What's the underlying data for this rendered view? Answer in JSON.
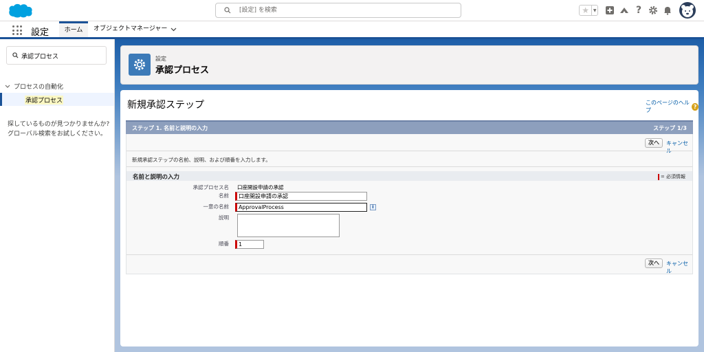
{
  "header": {
    "search_placeholder": "[設定] を検索"
  },
  "app_nav": {
    "app_name": "設定",
    "tabs": [
      {
        "label": "ホーム"
      },
      {
        "label": "オブジェクトマネージャー"
      }
    ]
  },
  "sidebar": {
    "quick_find_value": "承認プロセス",
    "tree_parent": "プロセスの自動化",
    "tree_child": "承認プロセス",
    "not_found_line1": "探しているものが見つかりませんか?",
    "not_found_line2": "グローバル検索をお試しください。"
  },
  "page_header": {
    "breadcrumb": "設定",
    "title": "承認プロセス"
  },
  "content": {
    "title": "新規承認ステップ",
    "help_link": "このページのヘルプ",
    "step_label": "ステップ 1. 名前と説明の入力",
    "step_count": "ステップ 1/3",
    "next_button": "次へ",
    "cancel_link": "キャンセル",
    "intro": "新規承認ステップの名前、説明、および順番を入力します。",
    "section_title": "名前と説明の入力",
    "required_info": "= 必須情報",
    "fields": {
      "process_name_label": "承認プロセス名",
      "process_name_value": "口座開設申請の承認",
      "name_label": "名前",
      "name_value": "口座開設申請の承認",
      "unique_name_label": "一意の名前",
      "unique_name_value": "ApprovalProcess",
      "description_label": "説明",
      "description_value": "",
      "order_label": "順番",
      "order_value": "1"
    }
  }
}
